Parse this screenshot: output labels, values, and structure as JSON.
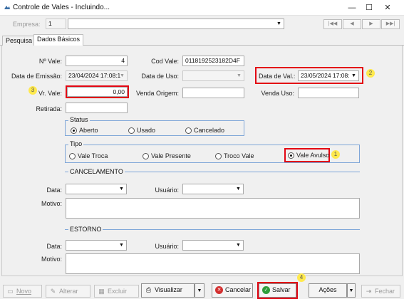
{
  "window": {
    "title": "Controle de Vales - Incluindo...",
    "minimize": "—",
    "maximize": "☐",
    "close": "✕"
  },
  "empresa": {
    "label": "Empresa:",
    "code": "1",
    "name": ""
  },
  "nav": {
    "first": "|◀◀",
    "prev": "◀",
    "next": "▶",
    "last": "▶▶|"
  },
  "tabs": [
    "Pesquisa",
    "Dados Básicos"
  ],
  "form": {
    "nvale_label": "Nº Vale:",
    "nvale": "4",
    "codvale_label": "Cod Vale:",
    "codvale": "0118192523182D4F",
    "emissao_label": "Data de Emissão:",
    "emissao": "23/04/2024 17:08:1",
    "uso_label": "Data de Uso:",
    "uso": "",
    "validade_label": "Data de Val.:",
    "validade": "23/05/2024 17:08:",
    "vrvale_label": "Vr. Vale:",
    "vrvale": "0,00",
    "venda_origem_label": "Venda Origem:",
    "venda_origem": "",
    "venda_uso_label": "Venda Uso:",
    "venda_uso": "",
    "retirada_label": "Retirada:",
    "retirada": ""
  },
  "status": {
    "title": "Status",
    "options": [
      "Aberto",
      "Usado",
      "Cancelado"
    ],
    "selected": "Aberto"
  },
  "tipo": {
    "title": "Tipo",
    "options": [
      "Vale Troca",
      "Vale Presente",
      "Troco Vale",
      "Vale Avulso"
    ],
    "selected": "Vale Avulso"
  },
  "cancelamento": {
    "title": "CANCELAMENTO",
    "data_label": "Data:",
    "usuario_label": "Usuário:",
    "motivo_label": "Motivo:"
  },
  "estorno": {
    "title": "ESTORNO",
    "data_label": "Data:",
    "usuario_label": "Usuário:",
    "motivo_label": "Motivo:"
  },
  "callouts": [
    "1",
    "2",
    "3",
    "4"
  ],
  "buttons": {
    "novo": "Novo",
    "alterar": "Alterar",
    "excluir": "Excluir",
    "visualizar": "Visualizar",
    "cancelar": "Cancelar",
    "salvar": "Salvar",
    "acoes": "Ações",
    "fechar": "Fechar"
  },
  "colors": {
    "highlight": "#e30613",
    "callout": "#ffe94d",
    "group_border": "#7ea6d8",
    "salvar_icon": "#2e9d3a",
    "cancelar_icon": "#d32f2f"
  }
}
